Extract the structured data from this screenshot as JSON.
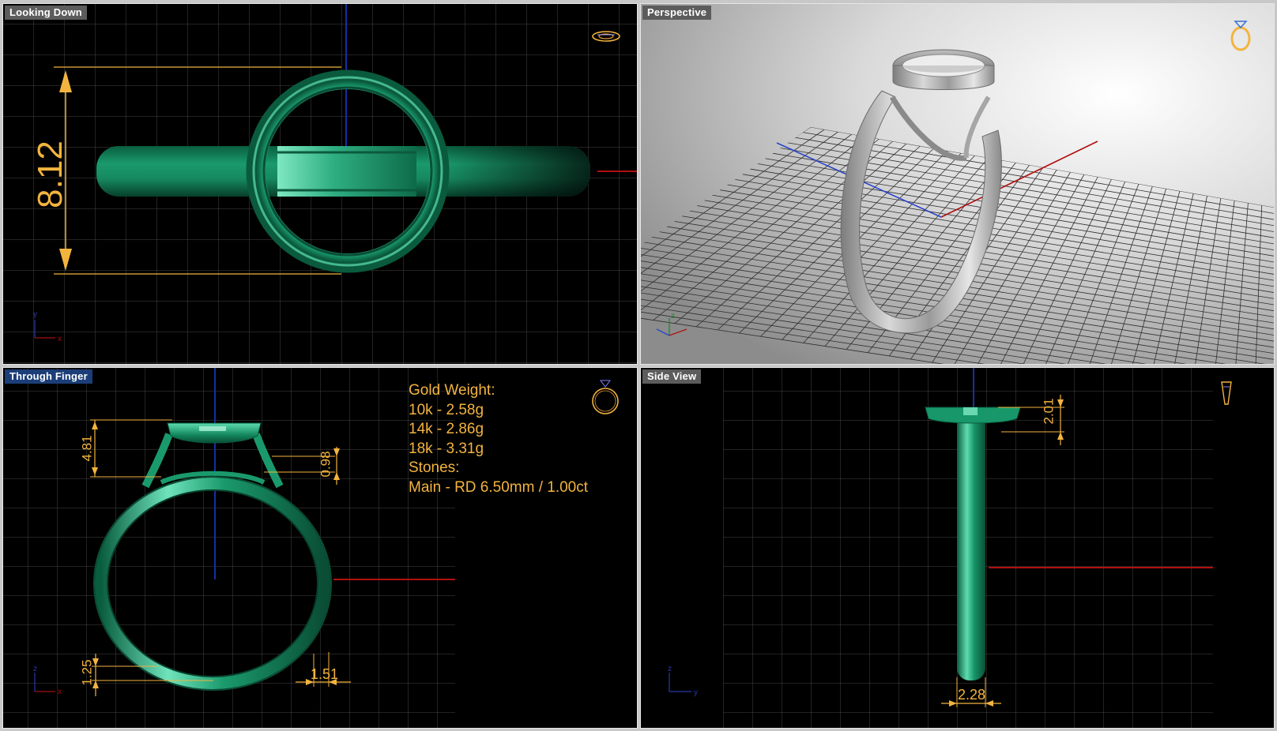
{
  "viewports": {
    "top": {
      "title": "Looking Down",
      "dimension": "8.12"
    },
    "perspective": {
      "title": "Perspective"
    },
    "front": {
      "title": "Through Finger",
      "dimensions": {
        "head_height": "4.81",
        "gallery_gap": "0.98",
        "bottom_thickness": "1.25",
        "shank_width": "1.51"
      },
      "notes": {
        "gold_weight_label": "Gold Weight:",
        "w10k": "10k - 2.58g",
        "w14k": "14k - 2.86g",
        "w18k": "18k - 3.31g",
        "stones_label": "Stones:",
        "main_stone": "Main - RD 6.50mm / 1.00ct"
      }
    },
    "side": {
      "title": "Side View",
      "dimensions": {
        "head_depth": "2.01",
        "band_width": "2.28"
      }
    }
  },
  "axes": {
    "x": "x",
    "y": "y",
    "z": "z"
  },
  "colors": {
    "dimension": "#f3b43f",
    "ring_green": "#17976a",
    "grid": "#4a4a4a",
    "x_axis": "#b01010",
    "y_axis": "#1430a0",
    "active_title": "#1c3e78"
  },
  "icons": [
    "ring-top-icon",
    "ring-perspective-icon",
    "ring-front-icon",
    "ring-side-icon",
    "axis-triad-icon"
  ]
}
